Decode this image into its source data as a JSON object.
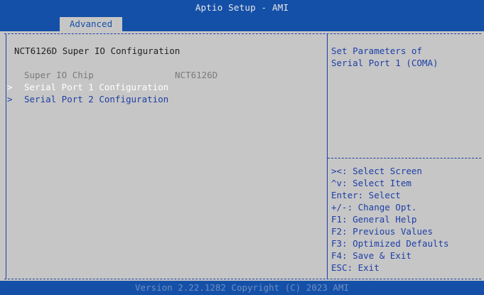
{
  "header": {
    "title": "Aptio Setup - AMI",
    "tab": "Advanced"
  },
  "main": {
    "section_title": "NCT6126D Super IO Configuration",
    "chip": {
      "label": "Super IO Chip",
      "value": "NCT6126D"
    },
    "items": [
      {
        "arrow": ">",
        "label": "Serial Port 1 Configuration"
      },
      {
        "arrow": ">",
        "label": "Serial Port 2 Configuration"
      }
    ]
  },
  "help": {
    "line1": "Set Parameters of",
    "line2": "Serial Port 1 (COMA)"
  },
  "keys": [
    "><: Select Screen",
    "^v: Select Item",
    "Enter: Select",
    "+/-: Change Opt.",
    "F1: General Help",
    "F2: Previous Values",
    "F3: Optimized Defaults",
    "F4: Save & Exit",
    "ESC: Exit"
  ],
  "footer": {
    "version": "Version 2.22.1282 Copyright (C) 2023 AMI"
  },
  "colors": {
    "header_bg": "#1550a8",
    "body_bg": "#c6c6c6",
    "text_blue": "#1d3fa6"
  }
}
